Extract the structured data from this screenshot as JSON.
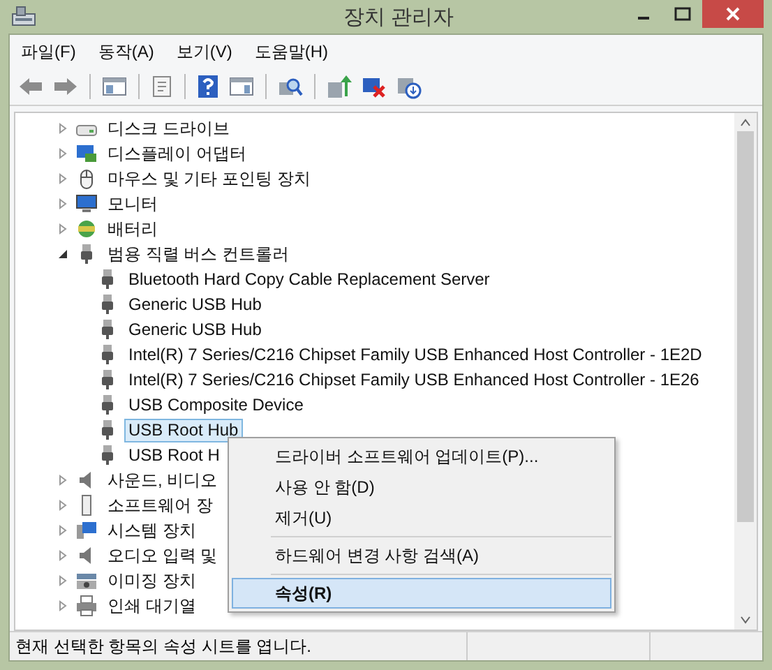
{
  "window": {
    "title": "장치 관리자"
  },
  "menu_bar": [
    {
      "label": "파일(F)"
    },
    {
      "label": "동작(A)"
    },
    {
      "label": "보기(V)"
    },
    {
      "label": "도움말(H)"
    }
  ],
  "tree": [
    {
      "label": "디스크 드라이브",
      "expanded": false,
      "selected": false
    },
    {
      "label": "디스플레이 어댑터",
      "expanded": false,
      "selected": false
    },
    {
      "label": "마우스 및 기타 포인팅 장치",
      "expanded": false,
      "selected": false
    },
    {
      "label": "모니터",
      "expanded": false,
      "selected": false
    },
    {
      "label": "배터리",
      "expanded": false,
      "selected": false
    },
    {
      "label": "범용 직렬 버스 컨트롤러",
      "expanded": true,
      "selected": false,
      "children": [
        {
          "label": "Bluetooth Hard Copy Cable Replacement Server",
          "selected": false
        },
        {
          "label": "Generic USB Hub",
          "selected": false
        },
        {
          "label": "Generic USB Hub",
          "selected": false
        },
        {
          "label": "Intel(R) 7 Series/C216 Chipset Family USB Enhanced Host Controller - 1E2D",
          "selected": false
        },
        {
          "label": "Intel(R) 7 Series/C216 Chipset Family USB Enhanced Host Controller - 1E26",
          "selected": false
        },
        {
          "label": "USB Composite Device",
          "selected": false
        },
        {
          "label": "USB Root Hub",
          "selected": true
        },
        {
          "label": "USB Root H",
          "selected": false
        }
      ]
    },
    {
      "label": "사운드, 비디오",
      "expanded": false,
      "selected": false
    },
    {
      "label": "소프트웨어 장",
      "expanded": false,
      "selected": false
    },
    {
      "label": "시스템 장치",
      "expanded": false,
      "selected": false
    },
    {
      "label": "오디오 입력 및",
      "expanded": false,
      "selected": false
    },
    {
      "label": "이미징 장치",
      "expanded": false,
      "selected": false
    },
    {
      "label": "인쇄 대기열",
      "expanded": false,
      "selected": false
    }
  ],
  "context_menu": [
    {
      "kind": "item",
      "label": "드라이버 소프트웨어 업데이트(P)...",
      "selected": false
    },
    {
      "kind": "item",
      "label": "사용 안 함(D)",
      "selected": false
    },
    {
      "kind": "item",
      "label": "제거(U)",
      "selected": false
    },
    {
      "kind": "separator"
    },
    {
      "kind": "item",
      "label": "하드웨어 변경 사항 검색(A)",
      "selected": false
    },
    {
      "kind": "separator"
    },
    {
      "kind": "item",
      "label": "속성(R)",
      "selected": true,
      "bold": true
    }
  ],
  "status_bar": {
    "text": "현재 선택한 항목의 속성 시트를 엽니다."
  }
}
